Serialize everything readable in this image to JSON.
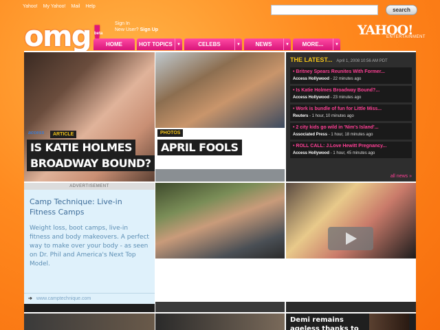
{
  "topnav": [
    "Yahoo!",
    "My Yahoo!",
    "Mail",
    "Help"
  ],
  "search": {
    "button": "search",
    "value": ""
  },
  "logo": {
    "text": "omg",
    "exclaim": "!",
    "badge": "beta"
  },
  "signin": {
    "link": "Sign In",
    "new_user": "New User?",
    "signup": "Sign Up"
  },
  "brand": {
    "name": "YAHOO!",
    "sub": "ENTERTAINMENT"
  },
  "tabs": [
    {
      "label": "HOME",
      "dropdown": false
    },
    {
      "label": "HOT TOPICS",
      "dropdown": true
    },
    {
      "label": "CELEBS",
      "dropdown": true
    },
    {
      "label": "NEWS",
      "dropdown": true
    },
    {
      "label": "MORE...",
      "dropdown": true
    }
  ],
  "features": {
    "katie": {
      "source": "access",
      "label": "ARTICLE",
      "title_line1": "IS KATIE HOLMES",
      "title_line2": "BROADWAY BOUND?"
    },
    "april": {
      "label": "PHOTOS",
      "title": "APRIL FOOLS"
    }
  },
  "latest": {
    "heading": "THE LATEST...",
    "timestamp": "April 1, 2008 10:56 AM PDT",
    "items": [
      {
        "title": "Britney Spears Reunites With Former...",
        "source": "Access Hollywood",
        "time": " - 22 minutes ago"
      },
      {
        "title": "Is Katie Holmes Broadway Bound?...",
        "source": "Access Hollywood",
        "time": " - 23 minutes ago"
      },
      {
        "title": "Work is bundle of fun for Little Miss...",
        "source": "Reuters",
        "time": " - 1 hour, 10 minutes ago"
      },
      {
        "title": "2 city kids go wild in 'Nim's Island'...",
        "source": "Associated Press",
        "time": " - 1 hour, 18 minutes ago"
      },
      {
        "title": "ROLL CALL: J.Love Hewitt Pregnancy...",
        "source": "Access Hollywood",
        "time": " - 1 hour, 45 minutes ago"
      }
    ],
    "all_news": "all news »"
  },
  "ad": {
    "label": "ADVERTISEMENT",
    "title": "Camp Technique: Live-in Fitness Camps",
    "text": "Weight loss, boot camps, live-in fitness and body makeovers. A perfect way to make over your body - as seen on Dr. Phil and America's Next Top Model.",
    "url": "www.camptechnique.com"
  },
  "bottom": {
    "demi_line1": "Demi remains",
    "demi_line2": "ageless thanks to"
  }
}
